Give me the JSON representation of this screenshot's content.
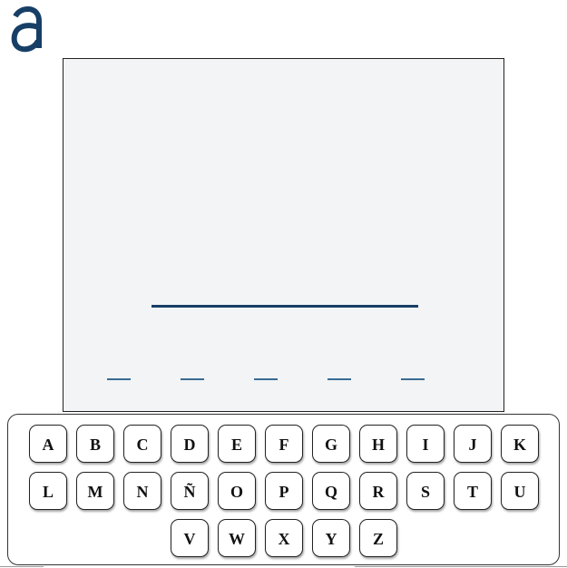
{
  "logo": {
    "icon": "logo-a-icon",
    "color": "#173f66"
  },
  "board": {
    "background": "#f2f4f6",
    "word_slots": [
      "",
      "",
      "",
      "",
      ""
    ],
    "slot_color": "#3b6b93"
  },
  "keyboard": {
    "rows": [
      [
        "A",
        "B",
        "C",
        "D",
        "E",
        "F",
        "G",
        "H",
        "I",
        "J",
        "K"
      ],
      [
        "L",
        "M",
        "N",
        "Ñ",
        "O",
        "P",
        "Q",
        "R",
        "S",
        "T",
        "U"
      ],
      [
        "V",
        "W",
        "X",
        "Y",
        "Z"
      ]
    ]
  }
}
